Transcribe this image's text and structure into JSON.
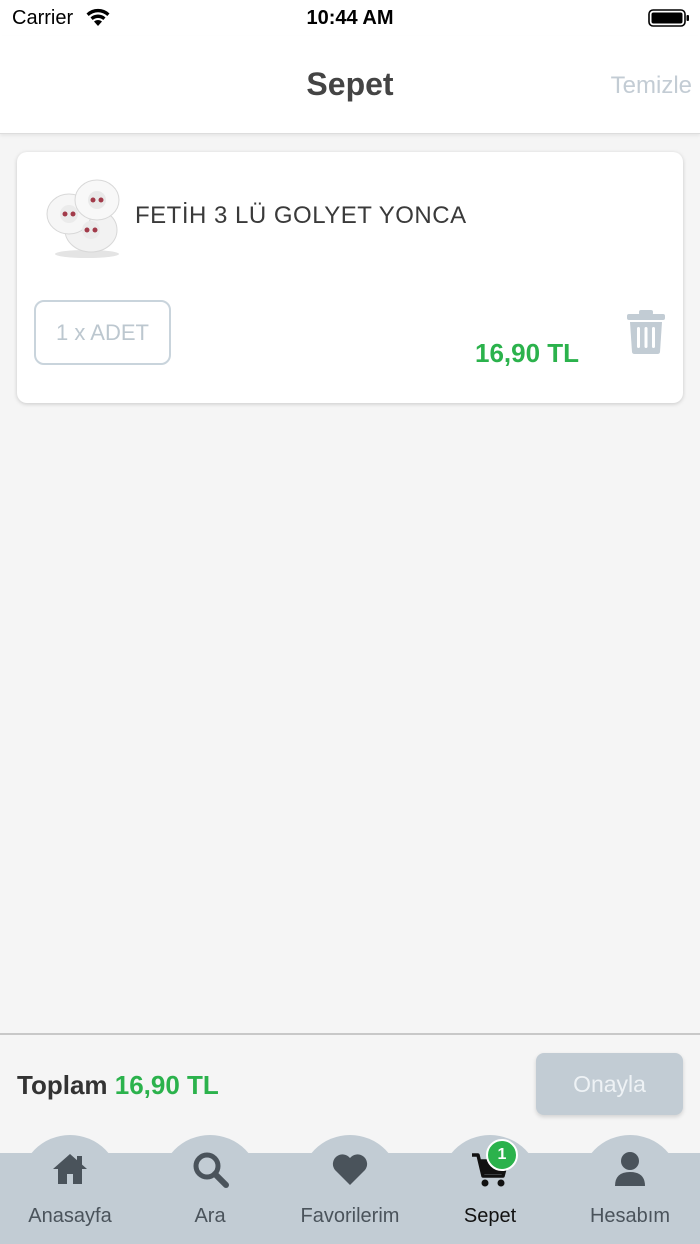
{
  "status_bar": {
    "carrier": "Carrier",
    "time": "10:44 AM"
  },
  "header": {
    "title": "Sepet",
    "clear_label": "Temizle"
  },
  "cart": {
    "items": [
      {
        "name": "FETİH 3 LÜ GOLYET YONCA",
        "quantity_label": "1 x ADET",
        "price": "16,90 TL"
      }
    ]
  },
  "summary": {
    "total_label": "Toplam",
    "total_value": "16,90 TL",
    "confirm_label": "Onayla"
  },
  "tab_bar": {
    "tabs": [
      {
        "label": "Anasayfa",
        "icon": "home-icon"
      },
      {
        "label": "Ara",
        "icon": "search-icon"
      },
      {
        "label": "Favorilerim",
        "icon": "heart-icon"
      },
      {
        "label": "Sepet",
        "icon": "cart-icon",
        "badge": "1",
        "active": true
      },
      {
        "label": "Hesabım",
        "icon": "user-icon"
      }
    ]
  },
  "colors": {
    "accent_green": "#2bb24c",
    "tab_bar_bg": "#c2ccd4",
    "muted_gray": "#c3ccd4"
  }
}
